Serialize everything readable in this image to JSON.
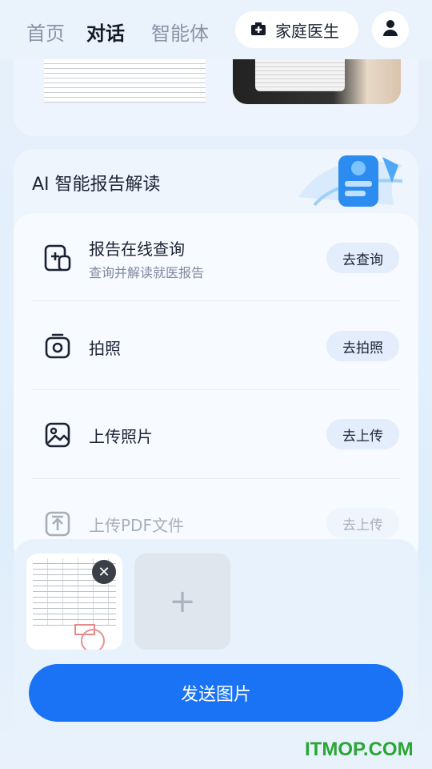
{
  "header": {
    "tabs": [
      {
        "label": "首页",
        "active": false
      },
      {
        "label": "对话",
        "active": true
      },
      {
        "label": "智能体",
        "active": false
      }
    ],
    "doctor_button": "家庭医生",
    "profile_icon": "user-icon"
  },
  "report": {
    "title": "AI 智能报告解读",
    "options": [
      {
        "title": "报告在线查询",
        "subtitle": "查询并解读就医报告",
        "button": "去查询",
        "icon": "report-search-icon"
      },
      {
        "title": "拍照",
        "subtitle": "",
        "button": "去拍照",
        "icon": "camera-icon"
      },
      {
        "title": "上传照片",
        "subtitle": "",
        "button": "去上传",
        "icon": "image-icon"
      },
      {
        "title": "上传PDF文件",
        "subtitle": "",
        "button": "去上传",
        "icon": "upload-file-icon"
      }
    ]
  },
  "upload": {
    "add_symbol": "+",
    "close_symbol": "✕",
    "send_label": "发送图片"
  },
  "watermark": "ITMOP.COM",
  "colors": {
    "accent": "#1a73f5",
    "background": "#e7f0fb",
    "watermark": "#2aa634"
  }
}
